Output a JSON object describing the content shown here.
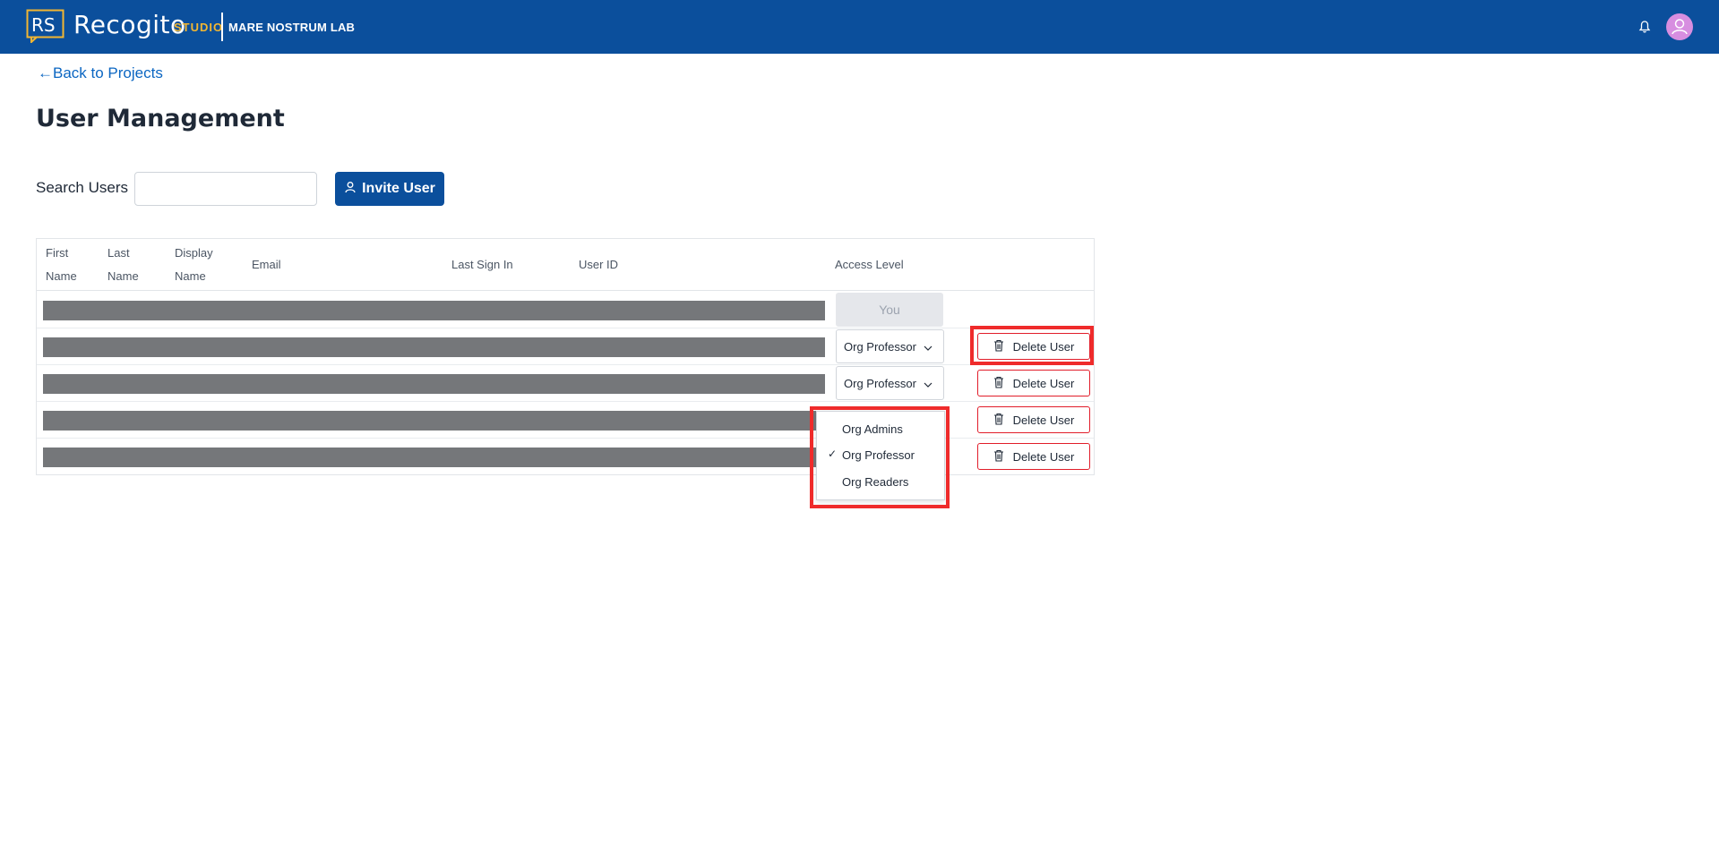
{
  "header": {
    "logo_text": "RS",
    "brand_name": "Recogito",
    "brand_suffix": "STUDIO",
    "org_name": "MARE NOSTRUM LAB",
    "colors": {
      "bar": "#0b4f9c",
      "accent": "#f2b632",
      "avatar": "#d78ee0"
    }
  },
  "nav": {
    "back_label": "Back to Projects"
  },
  "page": {
    "title": "User Management"
  },
  "search": {
    "label": "Search Users",
    "value": "",
    "placeholder": ""
  },
  "invite": {
    "label": "Invite User"
  },
  "table": {
    "columns": [
      {
        "line1": "First",
        "line2": "Name"
      },
      {
        "line1": "Last",
        "line2": "Name"
      },
      {
        "line1": "Display",
        "line2": "Name"
      },
      {
        "line1": "Email",
        "line2": ""
      },
      {
        "line1": "Last Sign In",
        "line2": ""
      },
      {
        "line1": "User ID",
        "line2": ""
      },
      {
        "line1": "Access Level",
        "line2": ""
      }
    ],
    "rows": [
      {
        "access": "You",
        "is_self": true
      },
      {
        "access": "Org Professor",
        "delete_label": "Delete User"
      },
      {
        "access": "Org Professor",
        "delete_label": "Delete User"
      },
      {
        "access": "",
        "delete_label": "Delete User"
      },
      {
        "access": "",
        "delete_label": "Delete User"
      }
    ]
  },
  "dropdown": {
    "options": [
      {
        "label": "Org Admins",
        "selected": false
      },
      {
        "label": "Org Professor",
        "selected": true
      },
      {
        "label": "Org Readers",
        "selected": false
      }
    ],
    "check_glyph": "✓"
  }
}
